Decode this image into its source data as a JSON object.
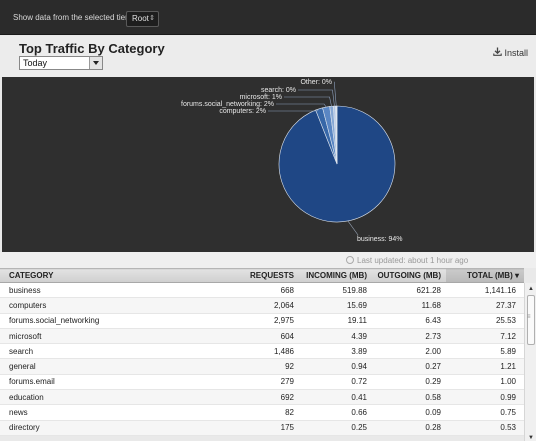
{
  "topbar": {
    "label": "Show data from the selected tier:",
    "tier_value": "Root",
    "tier_arrow": "⇕"
  },
  "panel": {
    "title": "Top Traffic By Category",
    "period_value": "Today",
    "install_label": "Install",
    "install_icon": "download-icon"
  },
  "status": {
    "last_updated": "Last updated: about 1 hour ago"
  },
  "chart_data": {
    "type": "pie",
    "slices": [
      {
        "label": "business",
        "value": 94,
        "display": "business: 94%",
        "color": "#1f4785"
      },
      {
        "label": "computers",
        "value": 2,
        "display": "computers: 2%",
        "color": "#3767a8"
      },
      {
        "label": "forums.social_networking",
        "value": 2,
        "display": "forums.social_networking: 2%",
        "color": "#5a86c3"
      },
      {
        "label": "microsoft",
        "value": 1,
        "display": "microsoft: 1%",
        "color": "#86a7d4"
      },
      {
        "label": "search",
        "value": 0.6,
        "display": "search: 0%",
        "color": "#b4c7e6"
      },
      {
        "label": "Other",
        "value": 0.4,
        "display": "Other: 0%",
        "color": "#dde6f2"
      }
    ],
    "colors": {
      "background": "#2f2f2f",
      "label_text": "#e8e8e8",
      "slice_stroke": "#dfe6ef"
    }
  },
  "table": {
    "columns": [
      "CATEGORY",
      "REQUESTS",
      "INCOMING (MB)",
      "OUTGOING (MB)",
      "TOTAL (MB)"
    ],
    "sort_indicator": "▾",
    "rows": [
      [
        "business",
        "668",
        "519.88",
        "621.28",
        "1,141.16"
      ],
      [
        "computers",
        "2,064",
        "15.69",
        "11.68",
        "27.37"
      ],
      [
        "forums.social_networking",
        "2,975",
        "19.11",
        "6.43",
        "25.53"
      ],
      [
        "microsoft",
        "604",
        "4.39",
        "2.73",
        "7.12"
      ],
      [
        "search",
        "1,486",
        "3.89",
        "2.00",
        "5.89"
      ],
      [
        "general",
        "92",
        "0.94",
        "0.27",
        "1.21"
      ],
      [
        "forums.email",
        "279",
        "0.72",
        "0.29",
        "1.00"
      ],
      [
        "education",
        "692",
        "0.41",
        "0.58",
        "0.99"
      ],
      [
        "news",
        "82",
        "0.66",
        "0.09",
        "0.75"
      ],
      [
        "directory",
        "175",
        "0.25",
        "0.28",
        "0.53"
      ]
    ]
  },
  "scrollbar": {
    "up": "▲",
    "down": "▼",
    "grip": "≡"
  }
}
